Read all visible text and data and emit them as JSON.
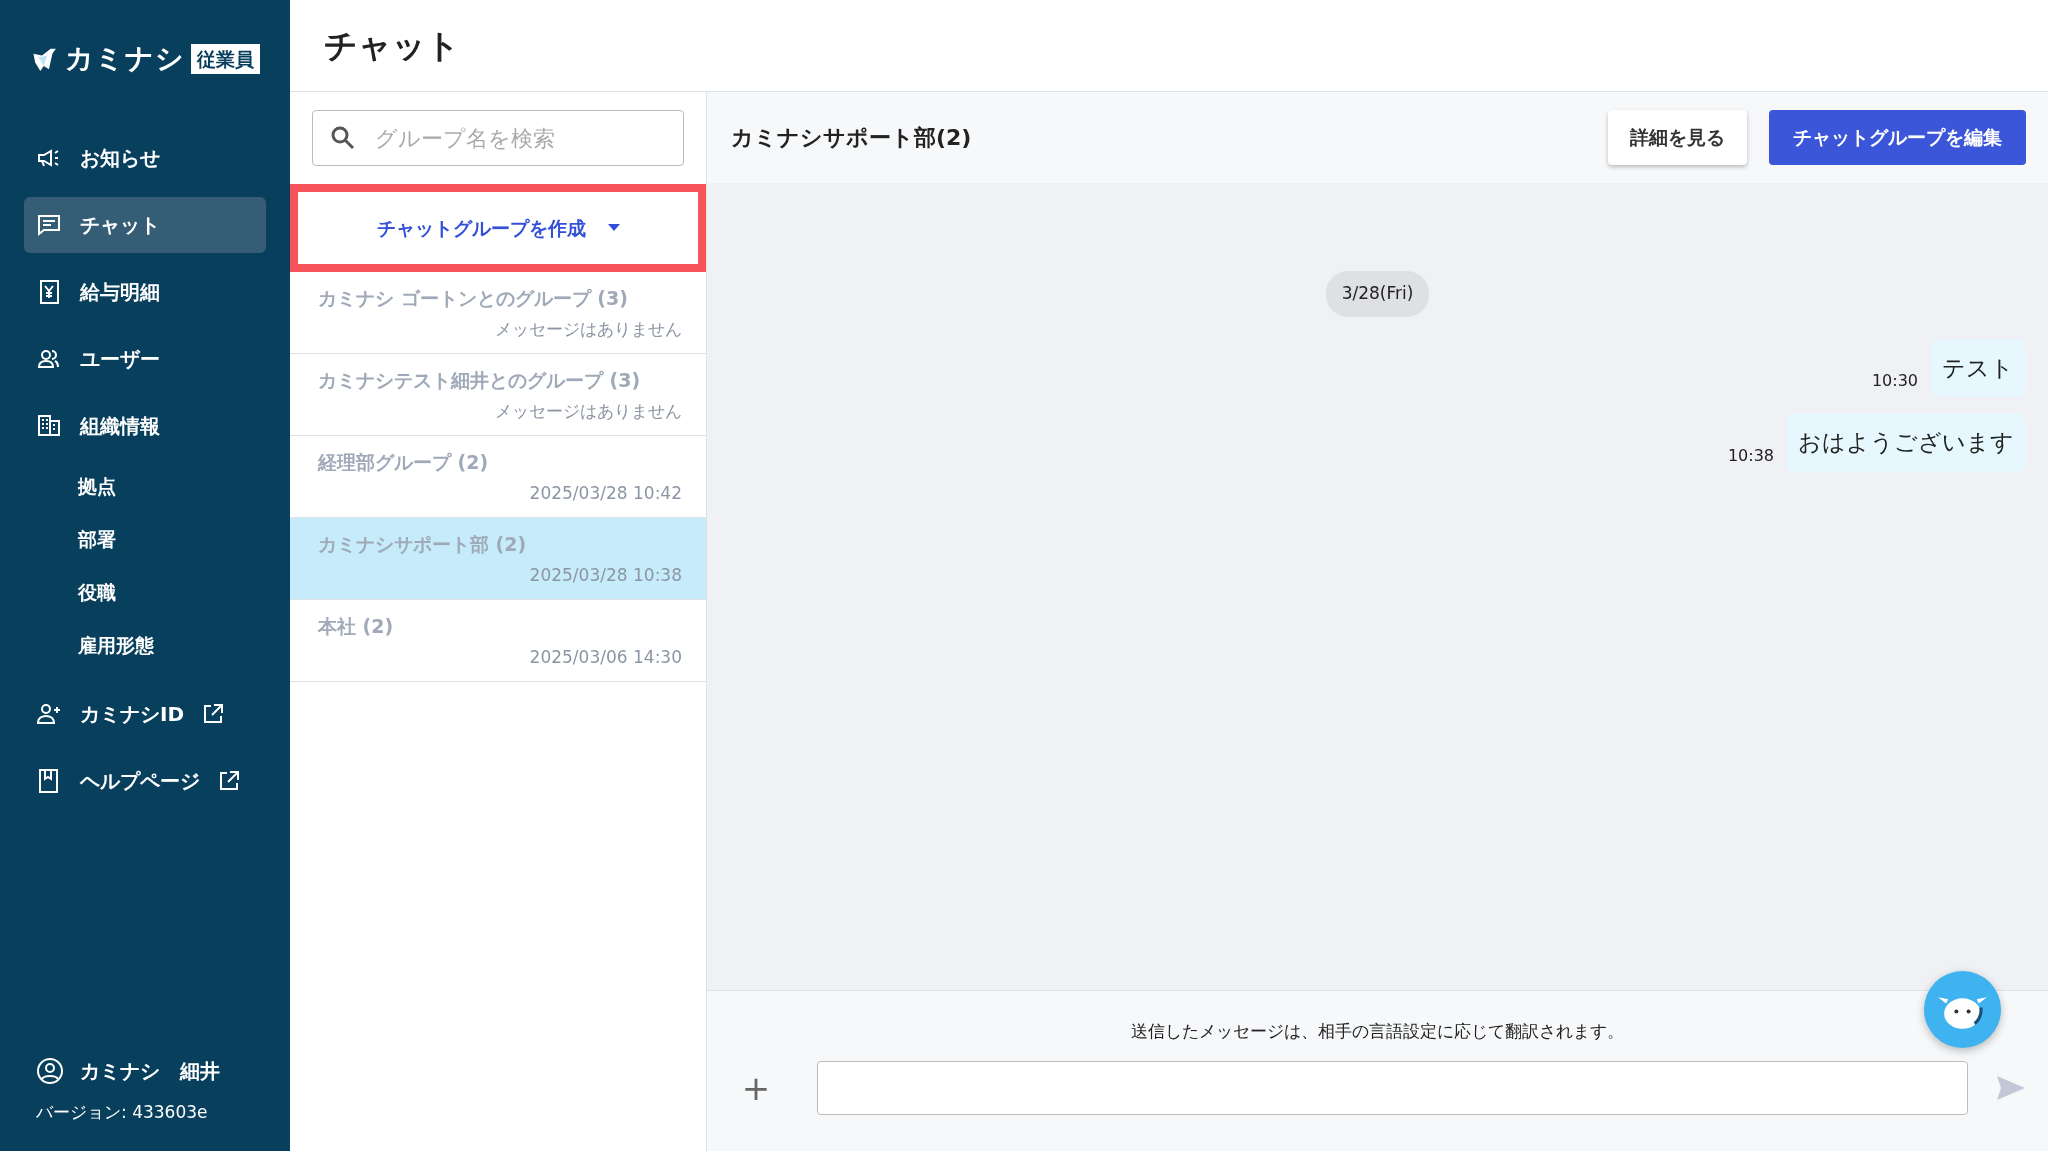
{
  "app": {
    "logo": "カミナシ",
    "badge": "従業員"
  },
  "sidebar": {
    "items": [
      {
        "label": "お知らせ",
        "kind": "main",
        "selected": false,
        "external": false
      },
      {
        "label": "チャット",
        "kind": "main",
        "selected": true,
        "external": false
      },
      {
        "label": "給与明細",
        "kind": "main",
        "selected": false,
        "external": false
      },
      {
        "label": "ユーザー",
        "kind": "main",
        "selected": false,
        "external": false
      },
      {
        "label": "組織情報",
        "kind": "main",
        "selected": false,
        "external": false
      },
      {
        "label": "拠点",
        "kind": "sub",
        "selected": false,
        "external": false
      },
      {
        "label": "部署",
        "kind": "sub",
        "selected": false,
        "external": false
      },
      {
        "label": "役職",
        "kind": "sub",
        "selected": false,
        "external": false
      },
      {
        "label": "雇用形態",
        "kind": "sub",
        "selected": false,
        "external": false
      },
      {
        "label": "カミナシID",
        "kind": "main",
        "selected": false,
        "external": true
      },
      {
        "label": "ヘルプページ",
        "kind": "main",
        "selected": false,
        "external": true
      }
    ],
    "user": "カミナシ　細井",
    "version": "バージョン: 433603e"
  },
  "page_title": "チャット",
  "group_list": {
    "search_placeholder": "グループ名を検索",
    "create_button": "チャットグループを作成",
    "create_highlighted": true,
    "groups": [
      {
        "name": "カミナシ ゴートンとのグループ (3)",
        "info": "メッセージはありません",
        "selected": false
      },
      {
        "name": "カミナシテスト細井とのグループ (3)",
        "info": "メッセージはありません",
        "selected": false
      },
      {
        "name": "経理部グループ (2)",
        "info": "2025/03/28 10:42",
        "selected": false
      },
      {
        "name": "カミナシサポート部 (2)",
        "info": "2025/03/28 10:38",
        "selected": true
      },
      {
        "name": "本社 (2)",
        "info": "2025/03/06 14:30",
        "selected": false
      }
    ]
  },
  "chat": {
    "title": "カミナシサポート部(2)",
    "details_button": "詳細を見る",
    "edit_button": "チャットグループを編集",
    "date_chip": "3/28(Fri)",
    "messages": [
      {
        "text": "テスト",
        "time": "10:30"
      },
      {
        "text": "おはようございます",
        "time": "10:38"
      }
    ],
    "notice": "送信したメッセージは、相手の言語設定に応じて翻訳されます。",
    "add_button": "+"
  }
}
